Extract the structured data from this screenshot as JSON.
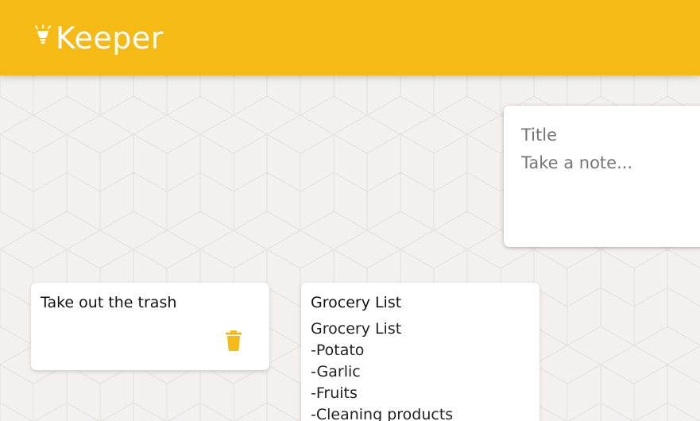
{
  "app": {
    "title": "Keeper",
    "icon": "lightbulb-icon",
    "accent_color": "#f5ba13"
  },
  "create_note": {
    "title_placeholder": "Title",
    "content_placeholder": "Take a note..."
  },
  "notes": [
    {
      "title": "Take out the trash",
      "content": "",
      "delete_icon": "trash-icon"
    },
    {
      "title": "Grocery List",
      "content": "Grocery List\n-Potato\n-Garlic\n-Fruits\n-Cleaning products",
      "delete_icon": "trash-icon"
    }
  ]
}
